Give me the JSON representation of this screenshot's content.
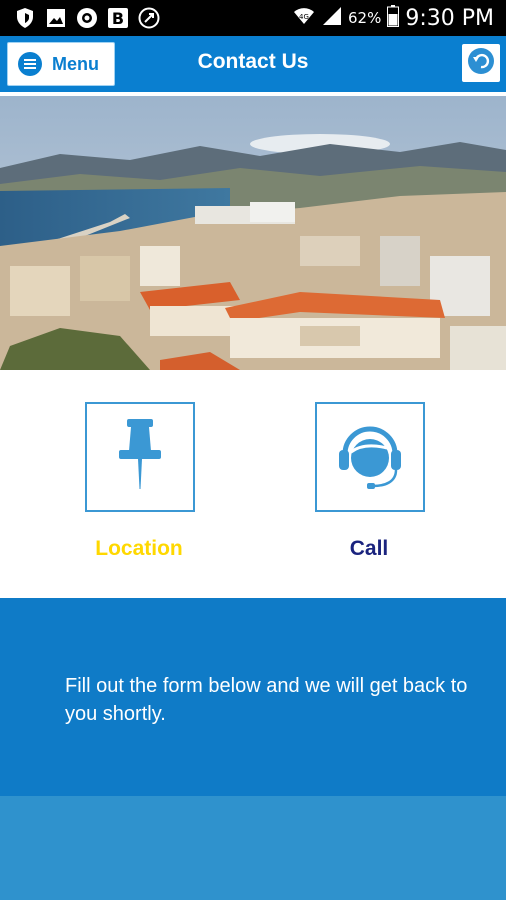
{
  "status_bar": {
    "icons": [
      "shield-icon",
      "image-icon",
      "vpn-icon",
      "b-app-icon",
      "clock-app-icon"
    ],
    "battery_percent": "62%",
    "time": "9:30 PM"
  },
  "header": {
    "menu_label": "Menu",
    "title": "Contact Us"
  },
  "actions": {
    "location_label": "Location",
    "call_label": "Call"
  },
  "info": {
    "text": "Fill out the form below and we will get back to you shortly."
  },
  "colors": {
    "primary": "#0a7fd0",
    "panel": "#0f7bc7",
    "form_area": "#2f92cd",
    "location_label": "#ffd800",
    "call_label": "#1a237e",
    "icon": "#3b98d4"
  }
}
